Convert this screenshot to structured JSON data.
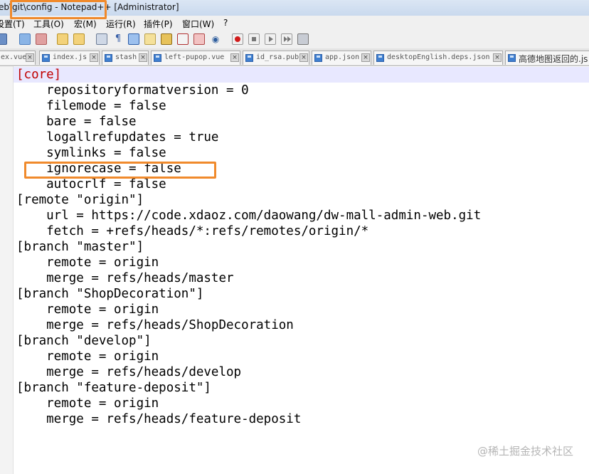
{
  "window": {
    "title": "eb\\git\\config - Notepad++ [Administrator]"
  },
  "menu": {
    "items": [
      "设置(T)",
      "工具(O)",
      "宏(M)",
      "运行(R)",
      "插件(P)",
      "窗口(W)",
      "?"
    ]
  },
  "toolbar": {
    "icons": [
      "find-icon",
      "replace-icon",
      "zoom-in-icon",
      "zoom-out-icon",
      "sync-scroll-icon",
      "word-wrap-icon",
      "show-all-chars-icon",
      "indent-guide-icon",
      "function-list-icon",
      "doc-map-icon",
      "monitor-icon",
      "record-macro-icon",
      "stop-macro-icon",
      "play-macro-icon",
      "run-macro-multiple-icon",
      "save-macro-icon"
    ]
  },
  "tabs": [
    {
      "label": "ex.vue"
    },
    {
      "label": "index.js"
    },
    {
      "label": "stash"
    },
    {
      "label": "left-pupop.vue"
    },
    {
      "label": "id_rsa.pub"
    },
    {
      "label": "app.json"
    },
    {
      "label": "desktopEnglish.deps.json"
    },
    {
      "label": "高德地图返回的.js"
    }
  ],
  "editor": {
    "lines": [
      "[core]",
      "    repositoryformatversion = 0",
      "    filemode = false",
      "    bare = false",
      "    logallrefupdates = true",
      "    symlinks = false",
      "    ignorecase = false",
      "    autocrlf = false",
      "[remote \"origin\"]",
      "    url = https://code.xdaoz.com/daowang/dw-mall-admin-web.git",
      "    fetch = +refs/heads/*:refs/remotes/origin/*",
      "[branch \"master\"]",
      "    remote = origin",
      "    merge = refs/heads/master",
      "[branch \"ShopDecoration\"]",
      "    remote = origin",
      "    merge = refs/heads/ShopDecoration",
      "[branch \"develop\"]",
      "    remote = origin",
      "    merge = refs/heads/develop",
      "[branch \"feature-deposit\"]",
      "    remote = origin",
      "    merge = refs/heads/feature-deposit"
    ]
  },
  "watermark": "@稀土掘金技术社区",
  "colors": {
    "highlight_box": "#f08a2c",
    "section_keyword": "#c00000",
    "current_line": "#e8e8ff"
  }
}
